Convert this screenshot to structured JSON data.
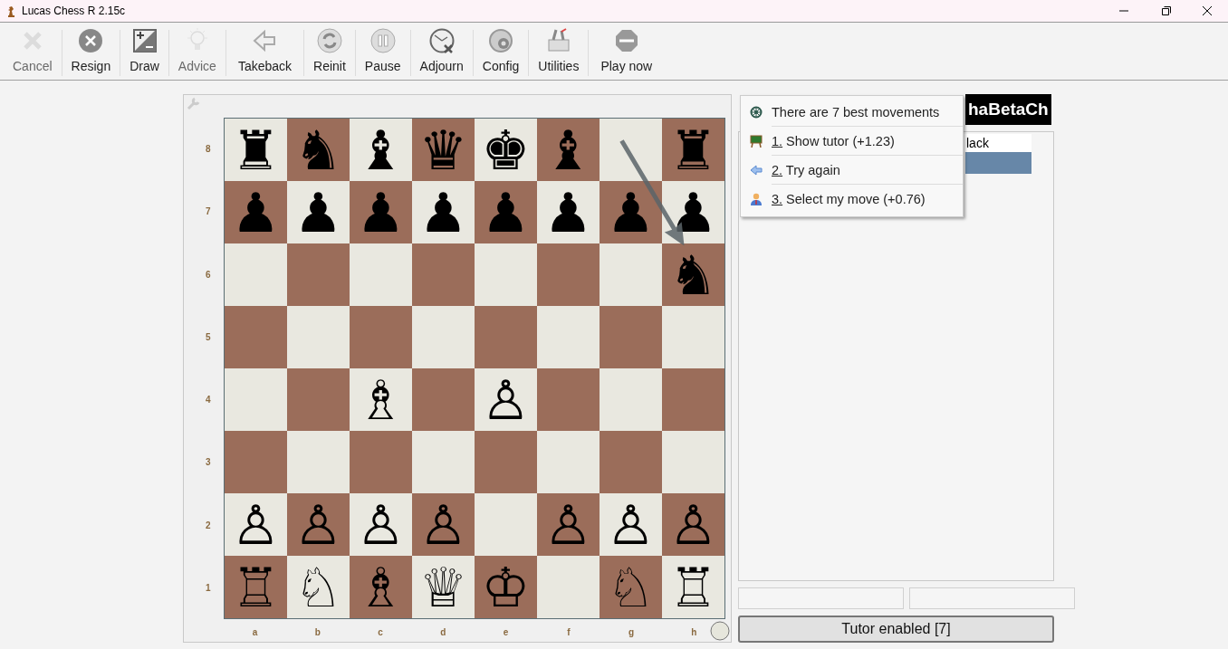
{
  "window": {
    "title": "Lucas Chess R 2.15c"
  },
  "toolbar": [
    {
      "label": "Cancel",
      "disabled": true
    },
    {
      "label": "Resign",
      "disabled": false
    },
    {
      "label": "Draw",
      "disabled": false
    },
    {
      "label": "Advice",
      "disabled": true
    },
    {
      "label": "Takeback",
      "disabled": false
    },
    {
      "label": "Reinit",
      "disabled": false
    },
    {
      "label": "Pause",
      "disabled": false
    },
    {
      "label": "Adjourn",
      "disabled": false
    },
    {
      "label": "Config",
      "disabled": false
    },
    {
      "label": "Utilities",
      "disabled": false
    },
    {
      "label": "Play now",
      "disabled": false
    }
  ],
  "board": {
    "ranks": [
      "8",
      "7",
      "6",
      "5",
      "4",
      "3",
      "2",
      "1"
    ],
    "files": [
      "a",
      "b",
      "c",
      "d",
      "e",
      "f",
      "g",
      "h"
    ],
    "rows": [
      {
        "col_1": "♜",
        "col_2": "♞",
        "col_3": "♝",
        "col_4": "♛",
        "col_5": "♚",
        "col_6": "♝",
        "col_8": "♜"
      },
      {
        "col_1": "♟",
        "col_2": "♟",
        "col_3": "♟",
        "col_4": "♟",
        "col_5": "♟",
        "col_6": "♟",
        "col_7": "♟",
        "col_8": "♟"
      },
      {
        "col_8": "♞"
      },
      {},
      {
        "col_3": "♗",
        "col_5": "♙"
      },
      {},
      {
        "col_1": "♙",
        "col_2": "♙",
        "col_3": "♙",
        "col_4": "♙",
        "col_6": "♙",
        "col_7": "♙",
        "col_8": "♙"
      },
      {
        "col_1": "♖",
        "col_2": "♘",
        "col_3": "♗",
        "col_4": "♕",
        "col_5": "♔",
        "col_7": "♘",
        "col_8": "♖"
      }
    ],
    "arrow_from_g8_to_h6": true
  },
  "panel": {
    "engine_label": "haBetaCh",
    "table": {
      "columns": [
        "lack"
      ],
      "rows": [
        {
          "selected": true
        }
      ]
    },
    "tutor_button": "Tutor enabled [7]"
  },
  "menu": [
    {
      "kind": "header",
      "label": "There are 7 best movements"
    },
    {
      "kind": "option",
      "label": "1. Show tutor (+1.23)"
    },
    {
      "kind": "option",
      "label": "2. Try again"
    },
    {
      "kind": "option",
      "label": "3. Select my move (+0.76)"
    }
  ]
}
